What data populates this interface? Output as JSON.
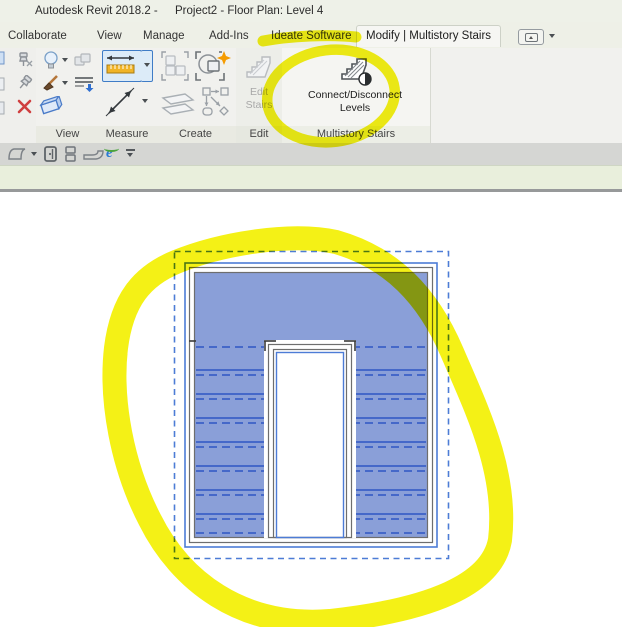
{
  "window": {
    "app_title": "Autodesk Revit 2018.2 -",
    "doc_title": "Project2 - Floor Plan: Level 4"
  },
  "tabs": {
    "items": [
      {
        "label": "Collaborate"
      },
      {
        "label": "View"
      },
      {
        "label": "Manage"
      },
      {
        "label": "Add-Ins"
      },
      {
        "label": "Ideate Software"
      },
      {
        "label": "Modify | Multistory Stairs",
        "active": true
      }
    ]
  },
  "ribbon": {
    "panels": [
      {
        "label": "View"
      },
      {
        "label": "Measure"
      },
      {
        "label": "Create"
      },
      {
        "label": "Edit"
      },
      {
        "label": "Multistory Stairs"
      }
    ],
    "buttons": {
      "edit_stairs": {
        "line1": "Edit",
        "line2": "Stairs",
        "state": "disabled"
      },
      "connect_disconnect": {
        "line1": "Connect/Disconnect",
        "line2": "Levels",
        "state": "enabled"
      }
    },
    "icons": [
      "unpin-icon",
      "pin-icon",
      "delete-icon",
      "lightbulb-icon",
      "default-3d-view-icon",
      "paintbrush-icon",
      "thin-lines-icon",
      "3d-box-icon",
      "measure-aligned-icon",
      "measure-between-icon",
      "create-group-icon",
      "create-similar-icon",
      "model-group-icon",
      "group-diagram-icon",
      "stairs-icon",
      "stairs-connect-icon"
    ]
  },
  "toolbar2": {
    "icons": [
      "extrusion-icon",
      "dropdown-caret-icon",
      "door-icon",
      "stacked-boxes-icon",
      "ramp-icon",
      "internet-explorer-icon",
      "collapse-icon"
    ],
    "ie_glyph": "e"
  },
  "canvas": {
    "content": "multistory-stair-plan-view",
    "selection_box_color": "#4D7CD6",
    "stair_fill_color": "#8A9FD8",
    "stair_line_color": "#2E56C4",
    "stair_outline_color": "#6E6E6E"
  },
  "annotations": {
    "highlighter_color": "#F4F109",
    "marks": [
      "swipe-over-ideate-software-tab",
      "circle-around-connect-disconnect-levels",
      "loop-around-stair-plan"
    ]
  }
}
